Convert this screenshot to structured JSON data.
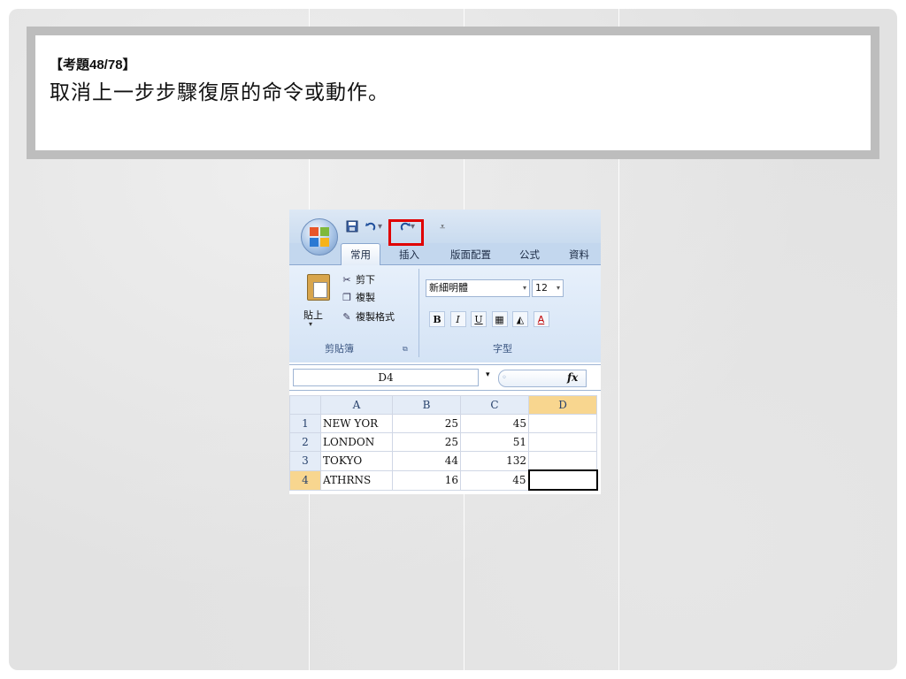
{
  "slide": {
    "question_label": "【考題48/78】",
    "question_text": "取消上一步步驟復原的命令或動作。"
  },
  "excel": {
    "qat": {
      "save_icon": "save-icon",
      "undo_icon": "undo-icon",
      "redo_icon": "redo-icon",
      "customize_icon": "customize-icon"
    },
    "tabs": [
      "常用",
      "插入",
      "版面配置",
      "公式",
      "資料"
    ],
    "active_tab_index": 0,
    "clipboard": {
      "paste": "貼上",
      "cut": "剪下",
      "copy": "複製",
      "format_painter": "複製格式",
      "group_label": "剪貼簿"
    },
    "font": {
      "font_name": "新細明體",
      "font_size": "12",
      "bold": "B",
      "italic": "I",
      "underline": "U",
      "group_label": "字型"
    },
    "formula_bar": {
      "name_box": "D4",
      "fx": "fx"
    },
    "grid": {
      "columns": [
        "A",
        "B",
        "C",
        "D"
      ],
      "rows": [
        {
          "num": "1",
          "a": "NEW YOR",
          "b": "25",
          "c": "45",
          "d": ""
        },
        {
          "num": "2",
          "a": "LONDON",
          "b": "25",
          "c": "51",
          "d": ""
        },
        {
          "num": "3",
          "a": "TOKYO",
          "b": "44",
          "c": "132",
          "d": ""
        },
        {
          "num": "4",
          "a": "ATHRNS",
          "b": "16",
          "c": "45",
          "d": ""
        }
      ],
      "active_cell": "D4"
    },
    "colors": {
      "highlight": "#e00000",
      "selected_header": "#f8d68f",
      "ribbon": "#d4e3f5"
    }
  }
}
